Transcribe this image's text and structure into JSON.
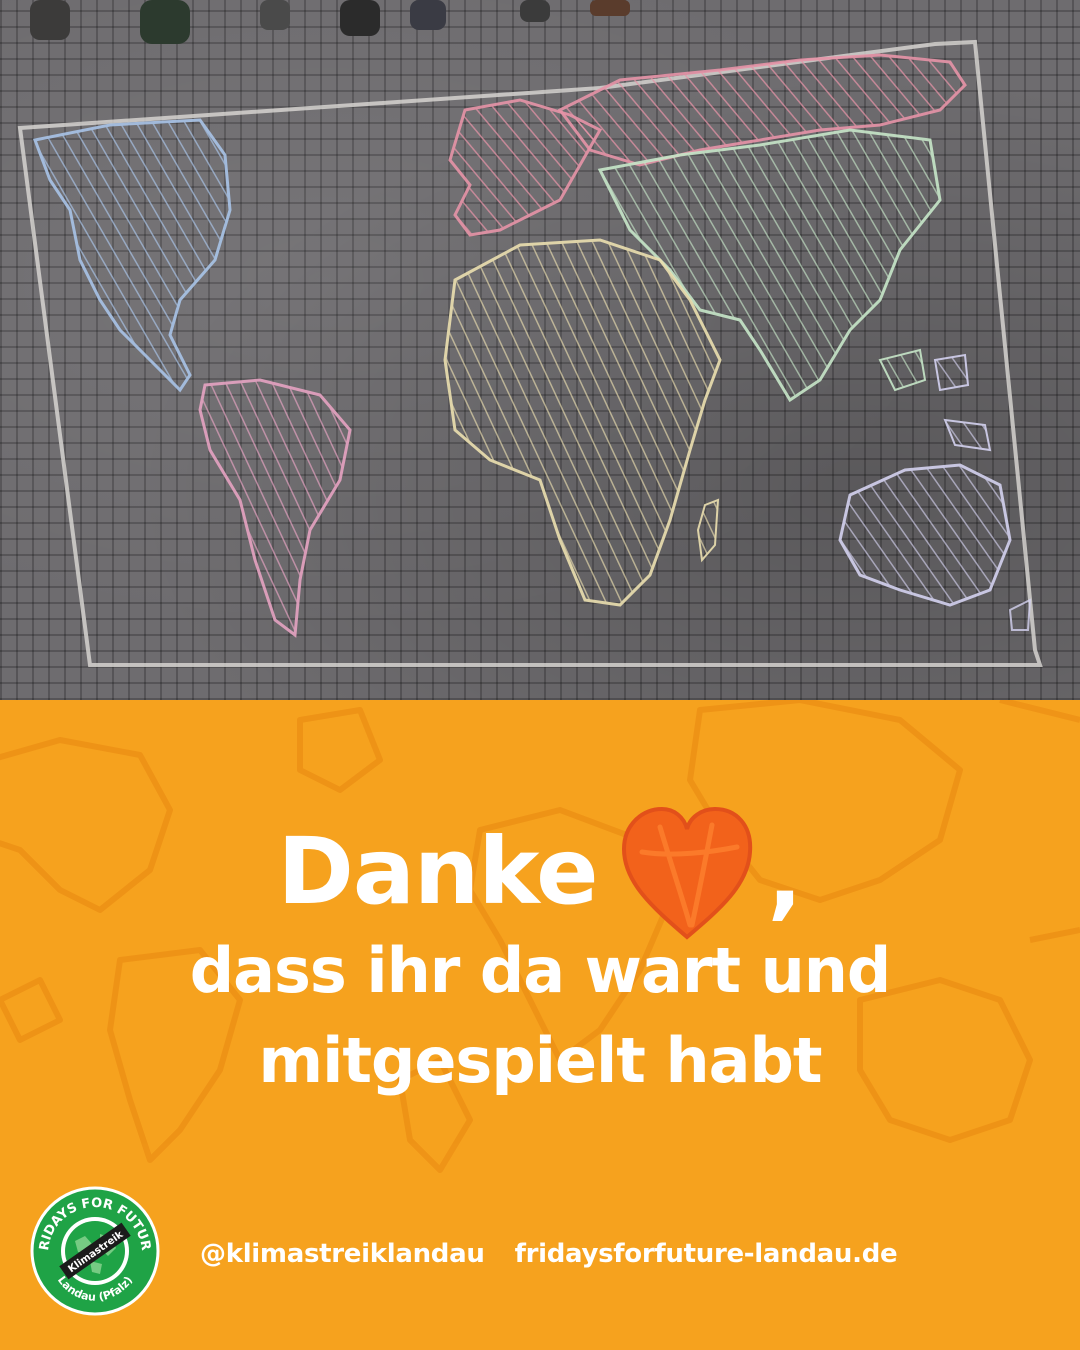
{
  "headline": {
    "word": "Danke",
    "comma": ",",
    "line1": "dass ihr da wart und",
    "line2": "mitgespielt habt"
  },
  "footer": {
    "instagram": "@klimastreiklandau",
    "website": "fridaysforfuture-landau.de"
  },
  "logo": {
    "top_text": "FRIDAYS FOR FUTURE",
    "center_text": "Klimastreik",
    "bottom_text": "Landau (Pfalz)"
  },
  "icons": {
    "heart": "heart-icon",
    "world_map": "world-map-icon",
    "logo": "fridays-for-future-logo-icon"
  },
  "colors": {
    "background_orange": "#f6a21e",
    "heart_orange": "#f2621b",
    "text": "#ffffff",
    "logo_green": "#1fa346"
  }
}
